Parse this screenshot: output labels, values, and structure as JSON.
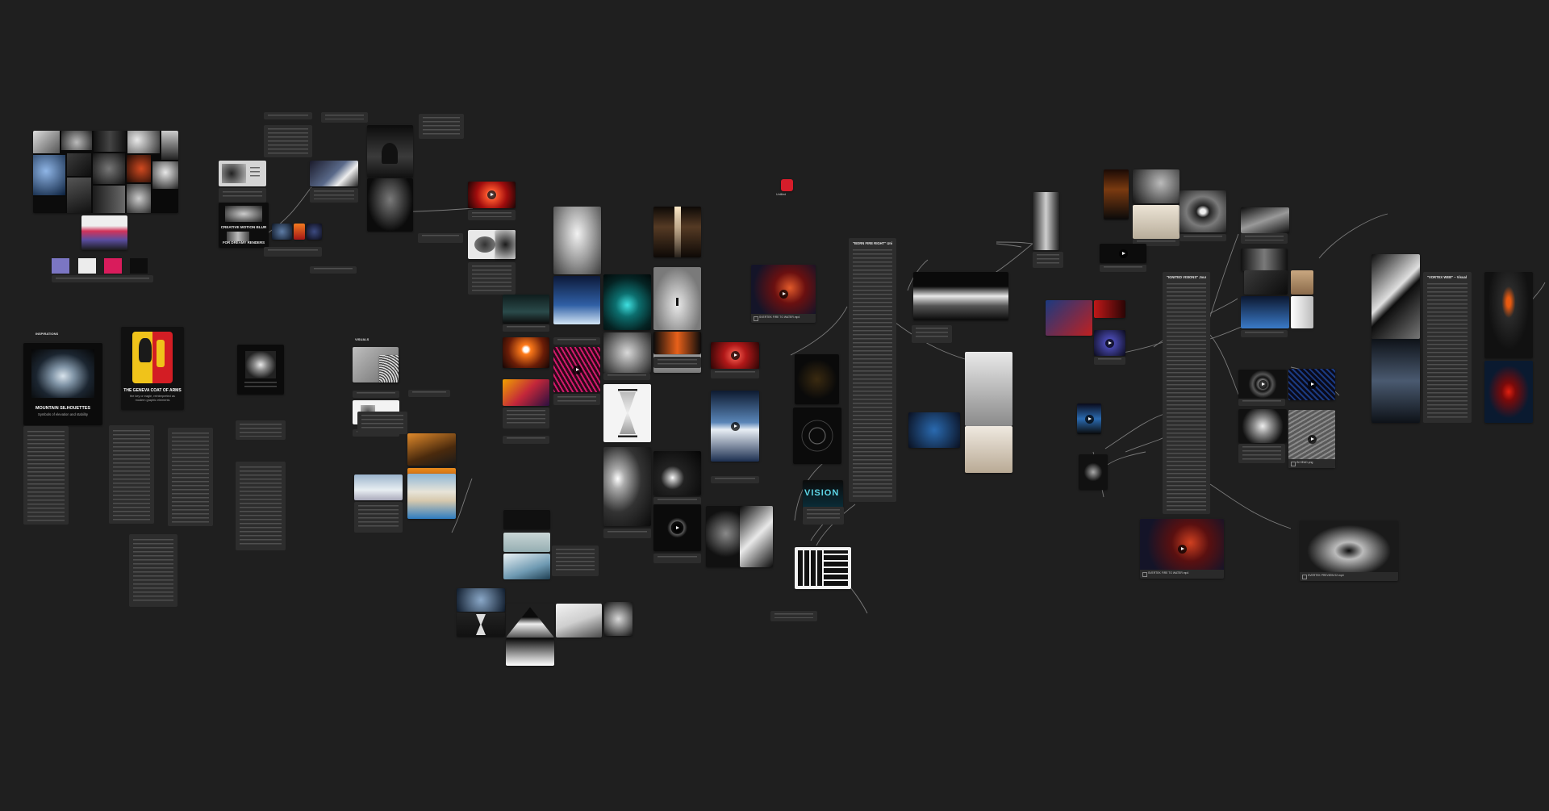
{
  "board": {
    "sections": {
      "inspiration": "INSPIRATIONS",
      "visuals": "VISUALS"
    },
    "card_titles": {
      "mountain": "MOUNTAIN SILHOUETTES",
      "mountain_sub": "Symbols of elevation and stability",
      "geneva": "THE GENEVA COAT OF ARMS",
      "geneva_sub": "the key or eagle, reinterpreted as modern graphic elements",
      "motion_blur": "CREATIVE MOTION BLUR",
      "dreamy": "FOR DREAMY RENDERS",
      "vision": "VISION"
    },
    "file_captions": {
      "video_a": "SVERTEK FIRE TO WATER.mp4",
      "video_b": "SVERTEK PREVIEW 02.mp4",
      "video_c": "SVERTEK FIRST SCULPTURE.mp4",
      "image_a": "IN HEAD.png"
    },
    "notes": {
      "born_fire": "\"BORN FIRE RIGHT\" Universal Video Idea",
      "ignited_visions": "\"IGNITED VISIONS\" Journey Banner Video 2024",
      "vortex": "\"VORTEX WEB\" – Visual Video 2.0"
    },
    "app_badge": "Untitled",
    "swatches": [
      {
        "name": "lavender",
        "color": "#7b76c3"
      },
      {
        "name": "white",
        "color": "#ececec"
      },
      {
        "name": "pink",
        "color": "#d91c5c"
      },
      {
        "name": "black",
        "color": "#0e0e0e"
      }
    ]
  }
}
